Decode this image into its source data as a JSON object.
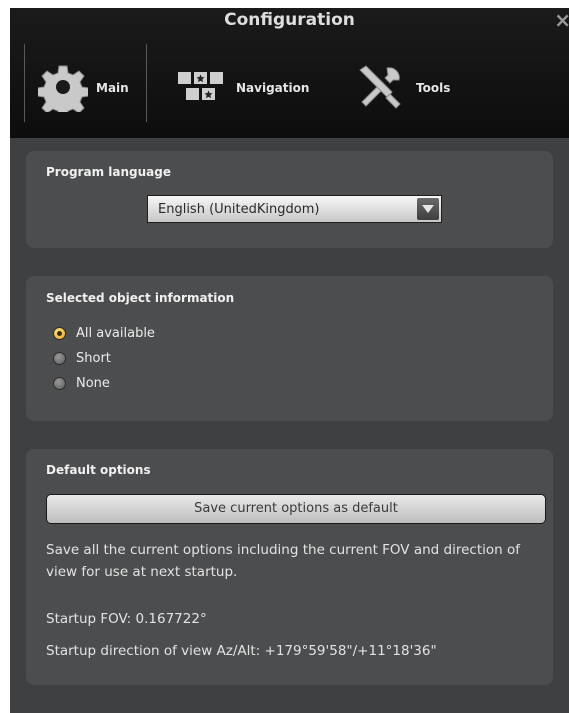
{
  "window": {
    "title": "Configuration",
    "close_symbol": "×"
  },
  "tabs": [
    {
      "label": "Main",
      "icon": "gear-icon"
    },
    {
      "label": "Navigation",
      "icon": "navigation-icon"
    },
    {
      "label": "Tools",
      "icon": "tools-icon"
    }
  ],
  "program_language": {
    "title": "Program language",
    "selected": "English (UnitedKingdom)"
  },
  "object_info": {
    "title": "Selected object information",
    "options": [
      {
        "label": "All available",
        "checked": true
      },
      {
        "label": "Short",
        "checked": false
      },
      {
        "label": "None",
        "checked": false
      }
    ]
  },
  "default_options": {
    "title": "Default options",
    "save_button": "Save current options as default",
    "description": "Save all the current options including the current FOV and direction of view for use at next startup.",
    "startup_fov": "Startup FOV: 0.167722°",
    "startup_direction": "Startup direction of view Az/Alt: +179°59'58\"/+11°18'36\""
  },
  "colors": {
    "window_bg": "#3f4042",
    "panel_bg": "#4c4d4f",
    "radio_checked": "#e3a21a"
  }
}
